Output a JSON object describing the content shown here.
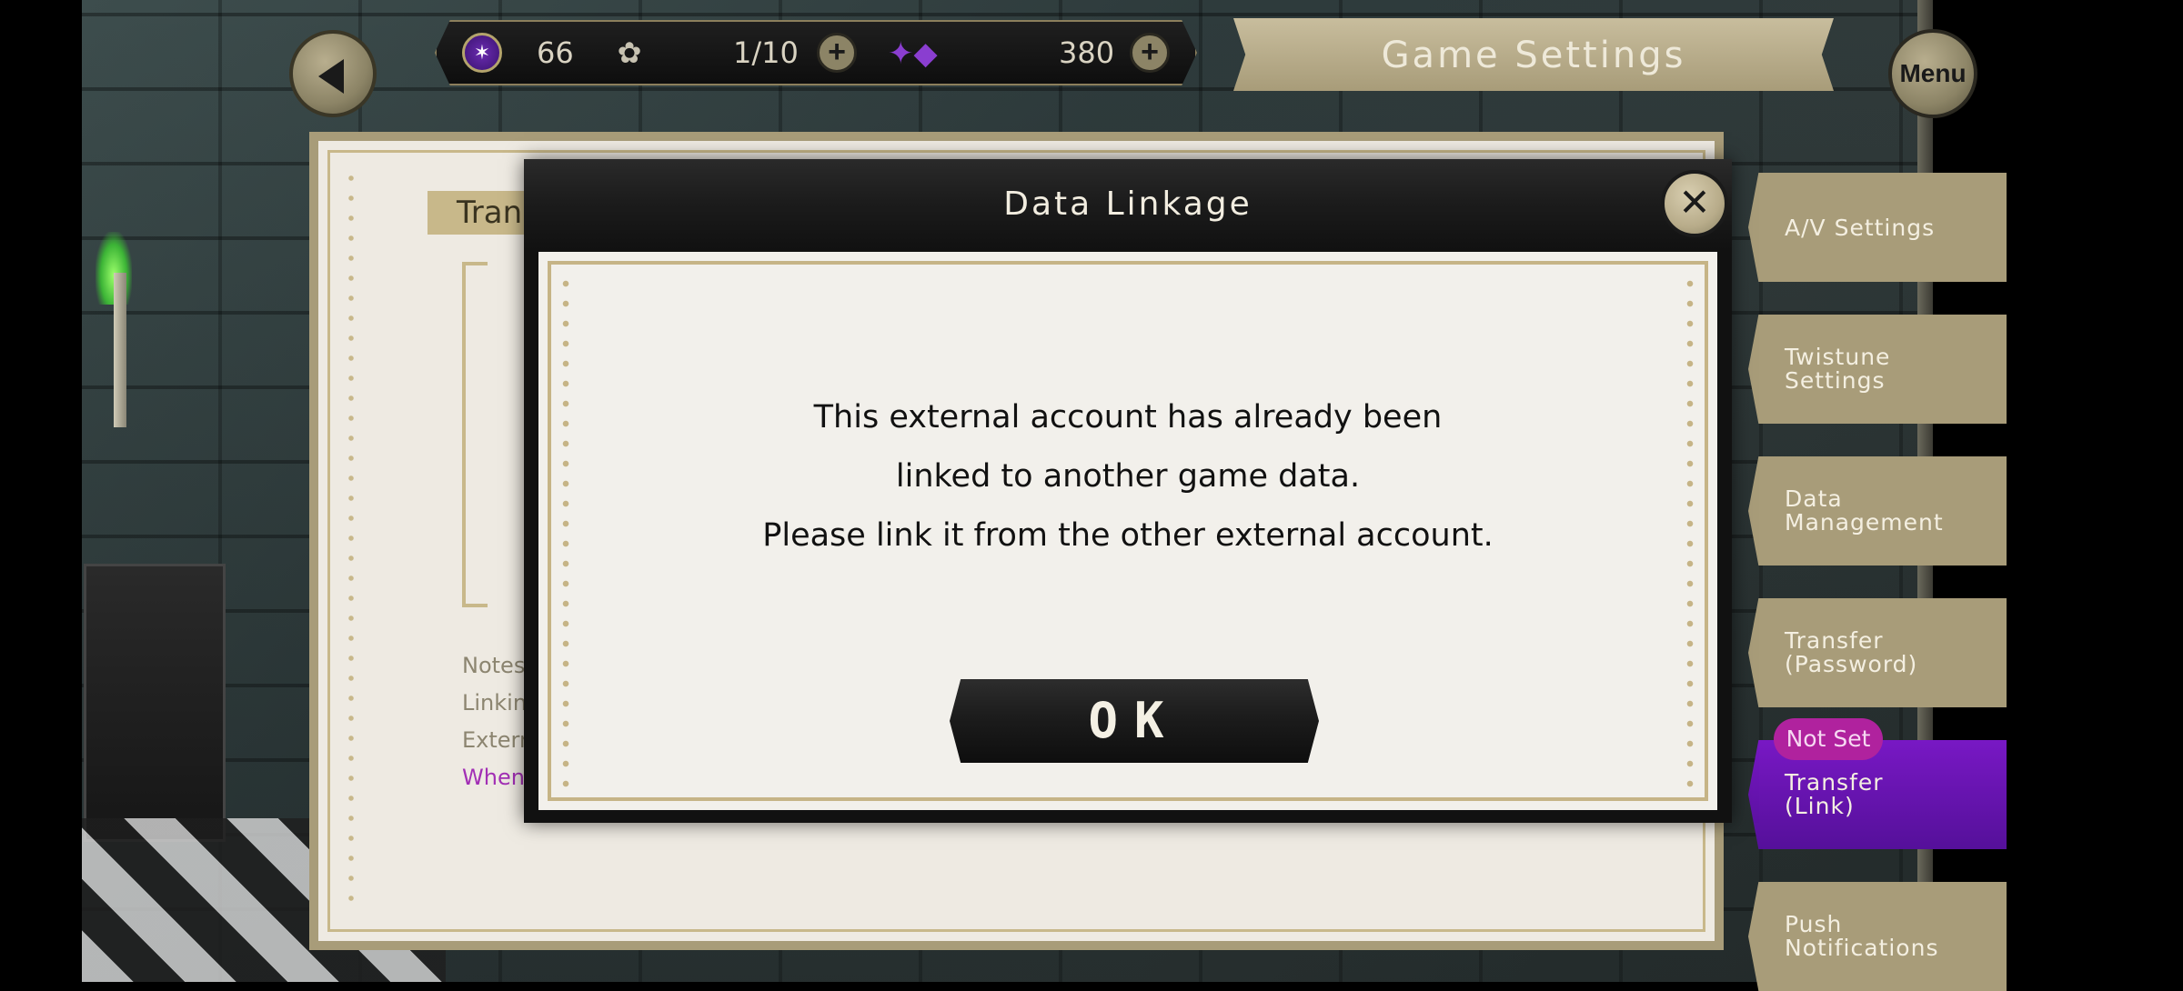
{
  "topbar": {
    "star_count": "66",
    "ticket_count": "1/10",
    "gem_count": "380",
    "title": "Game Settings",
    "menu_label": "Menu"
  },
  "settings_panel": {
    "section_title": "Tran",
    "notes": [
      "Notes:",
      "Linking",
      "Extern",
      "When"
    ]
  },
  "side_tabs": [
    {
      "label_line1": "A/V Settings",
      "label_line2": ""
    },
    {
      "label_line1": "Twistune",
      "label_line2": "Settings"
    },
    {
      "label_line1": "Data",
      "label_line2": "Management"
    },
    {
      "label_line1": "Transfer",
      "label_line2": "(Password)"
    },
    {
      "label_line1": "Transfer",
      "label_line2": "(Link)"
    },
    {
      "label_line1": "Push",
      "label_line2": "Notifications"
    }
  ],
  "badge": "Not Set",
  "dialog": {
    "title": "Data Linkage",
    "message_lines": [
      "This external account has already been",
      "linked to another game data.",
      "Please link it from the other external account."
    ],
    "ok_label": "OK"
  },
  "icons": {
    "back": "back-arrow-icon",
    "close": "close-icon",
    "star": "magic-star-icon",
    "paw": "ticket-icon",
    "gem": "gem-icon",
    "plus": "plus-icon"
  },
  "colors": {
    "accent_gold": "#a89c79",
    "active_tab": "#6a14b0",
    "badge": "#b0229e"
  }
}
